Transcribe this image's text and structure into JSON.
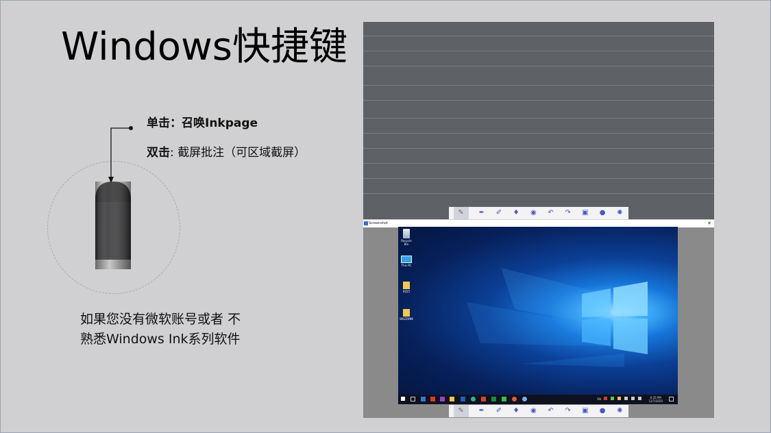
{
  "slide": {
    "title": "Windows快捷键",
    "single_click": "单击：召唤Inkpage",
    "double_click_label": "双击",
    "double_click_text": ": 截屏批注（可区域截屏）",
    "note_line1": "如果您没有微软账号或者 不",
    "note_line2": "熟悉Windows Ink系列软件"
  },
  "screenshot_window": {
    "title": "Screenshot",
    "close": "✕"
  },
  "desktop": {
    "icons": [
      {
        "label": "Recycle Bin",
        "icon": "recycle-bin-icon"
      },
      {
        "label": "This PC",
        "icon": "computer-icon"
      },
      {
        "label": "0025",
        "icon": "folder-icon"
      },
      {
        "label": "SKIZZ/INK",
        "icon": "folder-icon"
      }
    ],
    "taskbar": {
      "lang": "EN",
      "time": "6:35 PM",
      "date": "12/7/2020"
    }
  },
  "toolbar": {
    "tools": [
      "pen-select-icon",
      "pen-icon",
      "highlighter-icon",
      "marker-icon",
      "eraser-icon",
      "undo-icon",
      "redo-icon",
      "save-icon",
      "color-icon",
      "settings-icon"
    ]
  },
  "colors": {
    "slide_bg": "#d0d0d2",
    "board_bg": "#5e6166",
    "toolbar_accent": "#4a56c8"
  }
}
